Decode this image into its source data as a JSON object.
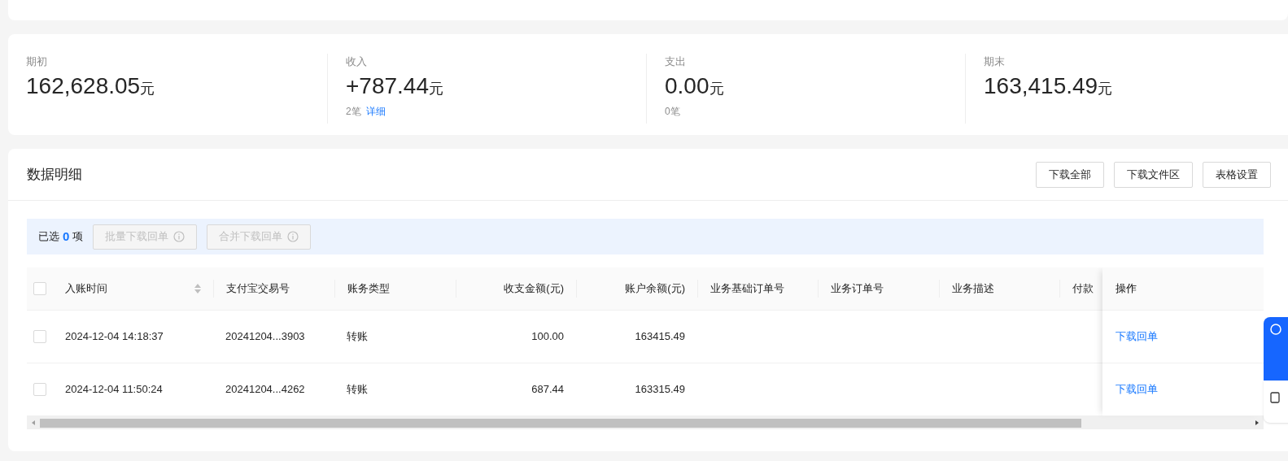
{
  "summary": [
    {
      "label": "期初",
      "amount": "162,628.05",
      "unit": "元"
    },
    {
      "label": "收入",
      "amount": "+787.44",
      "unit": "元",
      "count": "2笔",
      "link": "详细"
    },
    {
      "label": "支出",
      "amount": "0.00",
      "unit": "元",
      "count": "0笔"
    },
    {
      "label": "期末",
      "amount": "163,415.49",
      "unit": "元"
    }
  ],
  "details": {
    "title": "数据明细",
    "buttons": [
      "下载全部",
      "下载文件区",
      "表格设置"
    ],
    "selection": {
      "prefix": "已选",
      "count": "0",
      "suffix": "项",
      "actions": [
        {
          "label": "批量下载回单",
          "disabled": true
        },
        {
          "label": "合并下载回单",
          "disabled": true
        }
      ]
    },
    "table": {
      "select_all": {
        "checked": false
      },
      "columns": [
        {
          "label": "入账时间",
          "sortable": true
        },
        {
          "label": "支付宝交易号",
          "sortable": false
        },
        {
          "label": "账务类型",
          "sortable": false
        },
        {
          "label": "收支金额(元)",
          "sortable": false
        },
        {
          "label": "账户余额(元)",
          "sortable": false
        },
        {
          "label": "业务基础订单号",
          "sortable": false
        },
        {
          "label": "业务订单号",
          "sortable": false
        },
        {
          "label": "业务描述",
          "sortable": false
        },
        {
          "label": "付款",
          "sortable": false
        }
      ],
      "action_column": "操作",
      "rows": [
        {
          "checked": false,
          "cells": [
            "2024-12-04 14:18:37",
            "20241204...3903",
            "转账",
            "100.00",
            "163415.49"
          ],
          "action": "下载回单"
        },
        {
          "checked": false,
          "cells": [
            "2024-12-04 11:50:24",
            "20241204...4262",
            "转账",
            "687.44",
            "163315.49"
          ],
          "action": "下载回单"
        }
      ]
    }
  }
}
